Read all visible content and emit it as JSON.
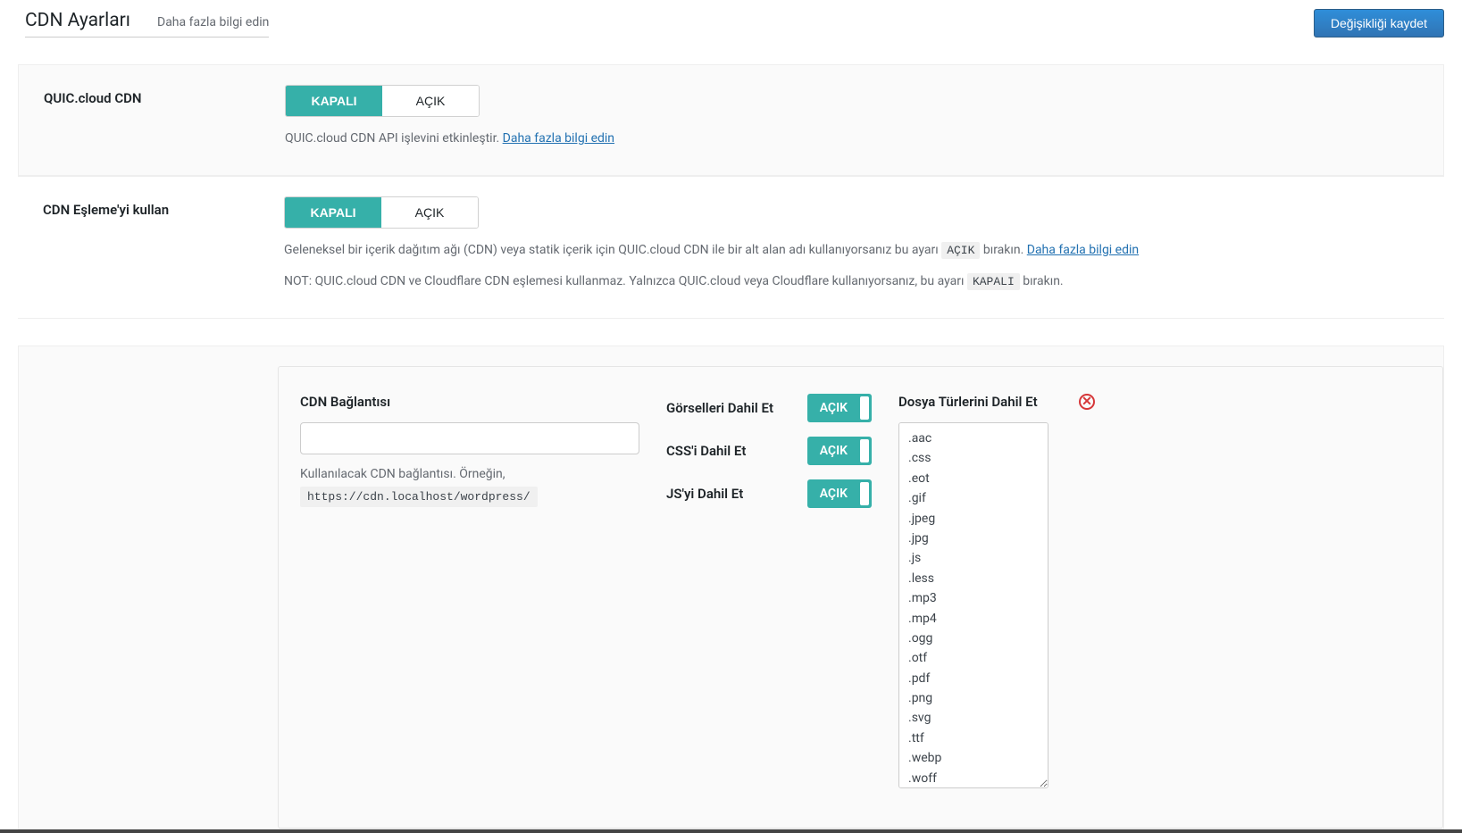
{
  "page": {
    "title": "CDN Ayarları",
    "learn_more": "Daha fazla bilgi edin",
    "save_button": "Değişikliği kaydet"
  },
  "toggles": {
    "off_label": "KAPALI",
    "on_label": "AÇIK"
  },
  "quic_cloud": {
    "label": "QUIC.cloud CDN",
    "desc_prefix": "QUIC.cloud CDN API işlevini etkinleştir. ",
    "learn_more": "Daha fazla bilgi edin"
  },
  "cdn_mapping": {
    "label": "CDN Eşleme'yi kullan",
    "desc1_prefix": "Geleneksel bir içerik dağıtım ağı (CDN) veya statik içerik için QUIC.cloud CDN ile bir alt alan adı kullanıyorsanız bu ayarı ",
    "desc1_code": "AÇIK",
    "desc1_suffix": " bırakın. ",
    "learn_more": "Daha fazla bilgi edin",
    "desc2_prefix": "NOT: QUIC.cloud CDN ve Cloudflare CDN eşlemesi kullanmaz. Yalnızca QUIC.cloud veya Cloudflare kullanıyorsanız, bu ayarı ",
    "desc2_code": "KAPALI",
    "desc2_suffix": " bırakın."
  },
  "mapping_panel": {
    "cdn_url_label": "CDN Bağlantısı",
    "cdn_url_value": "",
    "cdn_url_hint": "Kullanılacak CDN bağlantısı. Örneğin,",
    "cdn_url_example": "https://cdn.localhost/wordpress/",
    "include_images": "Görselleri Dahil Et",
    "include_css": "CSS'i Dahil Et",
    "include_js": "JS'yi Dahil Et",
    "mini_on": "AÇIK",
    "filetypes_label": "Dosya Türlerini Dahil Et",
    "filetypes": ".aac\n.css\n.eot\n.gif\n.jpeg\n.jpg\n.js\n.less\n.mp3\n.mp4\n.ogg\n.otf\n.pdf\n.png\n.svg\n.ttf\n.webp\n.woff"
  }
}
